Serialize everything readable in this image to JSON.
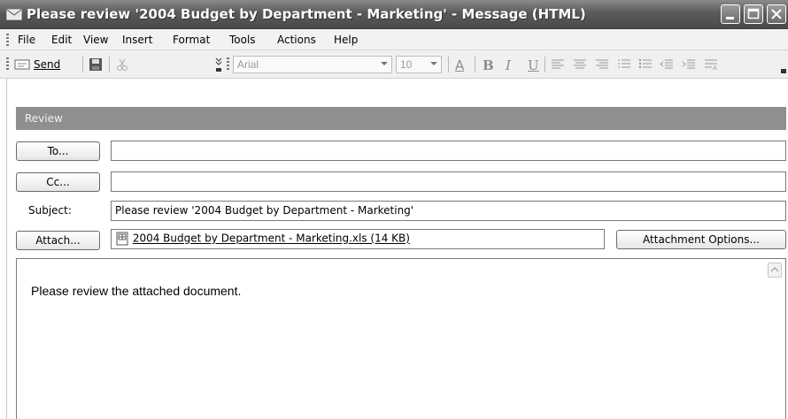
{
  "window": {
    "title": "Please review '2004 Budget by Department - Marketing' - Message (HTML)"
  },
  "menubar": {
    "items": [
      "File",
      "Edit",
      "View",
      "Insert",
      "Format",
      "Tools",
      "Actions",
      "Help"
    ]
  },
  "toolbar": {
    "send_label": "Send",
    "font_name": "Arial",
    "font_size": "10",
    "bold": "B",
    "italic": "I",
    "underline": "U",
    "font_color": "A"
  },
  "review_band": {
    "label": "Review"
  },
  "header": {
    "to_button": "To...",
    "to_value": "",
    "cc_button": "Cc...",
    "cc_value": "",
    "subject_label": "Subject:",
    "subject_value": "Please review '2004 Budget by Department - Marketing'",
    "attach_button": "Attach...",
    "attachment": "2004 Budget by Department - Marketing.xls (14 KB)",
    "attachment_options_button": "Attachment Options..."
  },
  "body": {
    "text": "Please review the attached document."
  },
  "colors": {
    "titlebar": "#5a5a5a",
    "review_band": "#8f8f8f"
  }
}
